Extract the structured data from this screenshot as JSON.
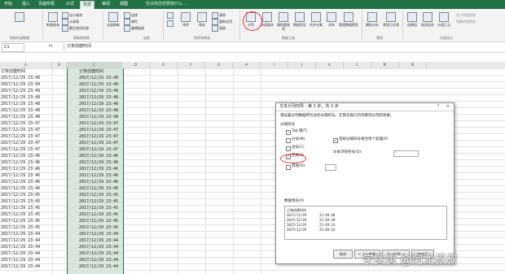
{
  "ribbon_tabs": [
    "开始",
    "插入",
    "页面布局",
    "公式",
    "数据",
    "审阅",
    "视图"
  ],
  "ribbon_active_tab": "数据",
  "tell_me": "告诉我您想要做什么...",
  "ribbon": {
    "get_external": "获取外部数据",
    "new_query": "新建查询",
    "show_queries": "显示查询",
    "from_table": "从表格",
    "recent_sources": "最近使用的源",
    "get_transform": "获取和转换",
    "refresh_all": "全部刷新",
    "connections": "连接",
    "properties": "属性",
    "edit_links": "编辑链接",
    "conn_group": "连接",
    "sort": "排序",
    "filter": "筛选",
    "clear": "清除",
    "reapply": "重新应用",
    "advanced": "高级",
    "sort_filter": "排序和筛选",
    "text_to_columns": "分列",
    "flash_fill": "快速填充",
    "remove_dup": "删除重复项",
    "validation": "数据验证",
    "consolidate": "合并计算",
    "relationships": "关系",
    "manage_model": "管理数据模型",
    "data_tools": "数据工具",
    "what_if": "模拟分析",
    "forecast": "预测工作表",
    "forecast_group": "预测",
    "group": "创建组",
    "ungroup": "取消组合",
    "subtotal": "分类汇总",
    "outline": "分级显示",
    "show_detail": "显示明细数据",
    "hide_detail": "隐藏明细数据"
  },
  "formula_bar": {
    "name_box": "C1",
    "fx": "fx",
    "value": "订单创建时间"
  },
  "columns": [
    "A",
    "B",
    "C",
    "D",
    "E",
    "F",
    "G",
    "H",
    "I",
    "J",
    "K",
    "L",
    "M",
    "N"
  ],
  "col_a": [
    "订单创建时间",
    "2017/12/29 23:49",
    "2017/12/29 23:49",
    "2017/12/29 23:49",
    "2017/12/29 23:48",
    "2017/12/29 23:48",
    "2017/12/29 23:48",
    "2017/12/29 23:48",
    "2017/12/29 23:47",
    "2017/12/29 23:47",
    "2017/12/29 23:47",
    "2017/12/29 23:47",
    "2017/12/29 23:47",
    "2017/12/29 23:46",
    "2017/12/29 23:46",
    "2017/12/29 23:46",
    "2017/12/29 23:46",
    "2017/12/29 23:46",
    "2017/12/29 23:46",
    "2017/12/29 23:45",
    "2017/12/29 23:45",
    "2017/12/29 23:45",
    "2017/12/29 23:45",
    "2017/12/29 23:45",
    "2017/12/29 23:45",
    "2017/12/29 23:44",
    "2017/12/29 23:44",
    "2017/12/29 23:44",
    "2017/12/29 23:44",
    "2017/12/29 23:44",
    "2017/12/29 23:44"
  ],
  "col_c": [
    "订单创建时间",
    "2017/12/29 23:49",
    "2017/12/29 23:49",
    "2017/12/29 23:49",
    "2017/12/29 23:48",
    "2017/12/29 23:48",
    "2017/12/29 23:48",
    "2017/12/29 23:48",
    "2017/12/29 23:47",
    "2017/12/29 23:47",
    "2017/12/29 23:47",
    "2017/12/29 23:47",
    "2017/12/29 23:47",
    "2017/12/29 23:46",
    "2017/12/29 23:46",
    "2017/12/29 23:46",
    "2017/12/29 23:46",
    "2017/12/29 23:46",
    "2017/12/29 23:46",
    "2017/12/29 23:45",
    "2017/12/29 23:45",
    "2017/12/29 23:45",
    "2017/12/29 23:45",
    "2017/12/29 23:45",
    "2017/12/29 23:45",
    "2017/12/29 23:44",
    "2017/12/29 23:44",
    "2017/12/29 23:44",
    "2017/12/29 23:44",
    "2017/12/29 23:44",
    "2017/12/29 23:44"
  ],
  "dialog": {
    "title": "文本分列向导 - 第 2 步，共 3 步",
    "help": "?",
    "close": "×",
    "instruction": "请设置分列数据所包含的分隔符号。在预览窗口内可看到分列的效果。",
    "delimiters_label": "分隔符号",
    "tab": "Tab 键(T)",
    "semicolon": "分号(M)",
    "comma": "逗号(C)",
    "space": "空格(S)",
    "other": "其他(O):",
    "consecutive": "连续分隔符号视为单个处理(R)",
    "qualifier_label": "文本识别符号(Q):",
    "qualifier_value": "\"",
    "preview_label": "数据预览(P)",
    "preview_rows": [
      [
        "订单创建时间",
        ""
      ],
      [
        "2017/12/29",
        "23:49:48"
      ],
      [
        "2017/12/29",
        "23:49:18"
      ],
      [
        "2017/12/29",
        "23:49:14"
      ],
      [
        "2017/12/29",
        "23:48:54"
      ]
    ],
    "btn_cancel": "取消",
    "btn_back": "< 上一步(B)",
    "btn_next": "下一步(N) >",
    "btn_finish": "完成(F)"
  },
  "watermark": "学买卖 @阿龙叔叔"
}
